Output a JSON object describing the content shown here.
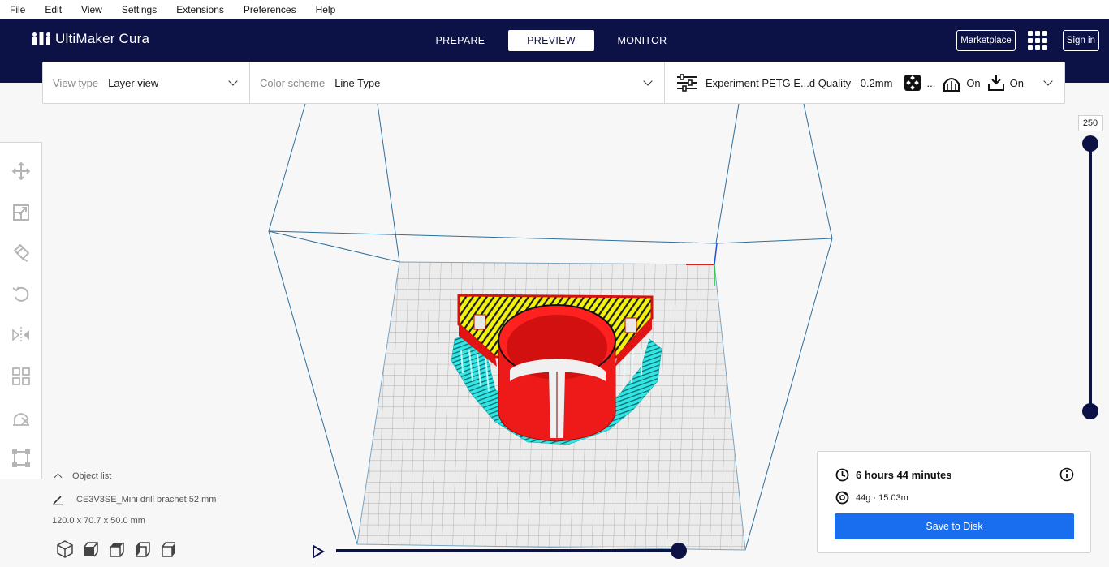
{
  "menu": [
    "File",
    "Edit",
    "View",
    "Settings",
    "Extensions",
    "Preferences",
    "Help"
  ],
  "app": {
    "brand": "UltiMaker Cura"
  },
  "tabs": [
    "PREPARE",
    "PREVIEW",
    "MONITOR"
  ],
  "header_right": {
    "marketplace": "Marketplace",
    "signin": "Sign in"
  },
  "setting_bar": {
    "view_type_label": "View type",
    "view_type_value": "Layer view",
    "color_scheme_label": "Color scheme",
    "color_scheme_value": "Line Type",
    "profile": "Experiment PETG E...d Quality - 0.2mm",
    "infill_value": "...",
    "support_value": "On",
    "adhesion_value": "On"
  },
  "object_list": {
    "title": "Object list",
    "item": "CE3V3SE_Mini drill brachet 52 mm",
    "dimensions": "120.0 x 70.7 x 50.0 mm"
  },
  "layer_slider": {
    "max_label": "250"
  },
  "print_info": {
    "time": "6 hours 44 minutes",
    "material": "44g · 15.03m",
    "save_button": "Save to Disk"
  },
  "colors": {
    "header_bg": "#0c1146",
    "accent_blue": "#196ef0",
    "wall_red": "#ff1a1a",
    "infill_yellow": "#f2f20a",
    "support_cyan": "#33e6e6"
  }
}
